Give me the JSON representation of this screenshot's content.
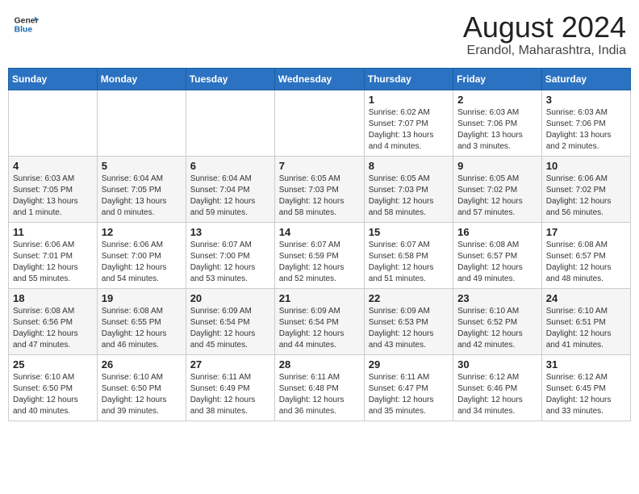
{
  "header": {
    "logo_line1": "General",
    "logo_line2": "Blue",
    "month": "August 2024",
    "location": "Erandol, Maharashtra, India"
  },
  "weekdays": [
    "Sunday",
    "Monday",
    "Tuesday",
    "Wednesday",
    "Thursday",
    "Friday",
    "Saturday"
  ],
  "weeks": [
    [
      {
        "day": "",
        "info": ""
      },
      {
        "day": "",
        "info": ""
      },
      {
        "day": "",
        "info": ""
      },
      {
        "day": "",
        "info": ""
      },
      {
        "day": "1",
        "info": "Sunrise: 6:02 AM\nSunset: 7:07 PM\nDaylight: 13 hours\nand 4 minutes."
      },
      {
        "day": "2",
        "info": "Sunrise: 6:03 AM\nSunset: 7:06 PM\nDaylight: 13 hours\nand 3 minutes."
      },
      {
        "day": "3",
        "info": "Sunrise: 6:03 AM\nSunset: 7:06 PM\nDaylight: 13 hours\nand 2 minutes."
      }
    ],
    [
      {
        "day": "4",
        "info": "Sunrise: 6:03 AM\nSunset: 7:05 PM\nDaylight: 13 hours\nand 1 minute."
      },
      {
        "day": "5",
        "info": "Sunrise: 6:04 AM\nSunset: 7:05 PM\nDaylight: 13 hours\nand 0 minutes."
      },
      {
        "day": "6",
        "info": "Sunrise: 6:04 AM\nSunset: 7:04 PM\nDaylight: 12 hours\nand 59 minutes."
      },
      {
        "day": "7",
        "info": "Sunrise: 6:05 AM\nSunset: 7:03 PM\nDaylight: 12 hours\nand 58 minutes."
      },
      {
        "day": "8",
        "info": "Sunrise: 6:05 AM\nSunset: 7:03 PM\nDaylight: 12 hours\nand 58 minutes."
      },
      {
        "day": "9",
        "info": "Sunrise: 6:05 AM\nSunset: 7:02 PM\nDaylight: 12 hours\nand 57 minutes."
      },
      {
        "day": "10",
        "info": "Sunrise: 6:06 AM\nSunset: 7:02 PM\nDaylight: 12 hours\nand 56 minutes."
      }
    ],
    [
      {
        "day": "11",
        "info": "Sunrise: 6:06 AM\nSunset: 7:01 PM\nDaylight: 12 hours\nand 55 minutes."
      },
      {
        "day": "12",
        "info": "Sunrise: 6:06 AM\nSunset: 7:00 PM\nDaylight: 12 hours\nand 54 minutes."
      },
      {
        "day": "13",
        "info": "Sunrise: 6:07 AM\nSunset: 7:00 PM\nDaylight: 12 hours\nand 53 minutes."
      },
      {
        "day": "14",
        "info": "Sunrise: 6:07 AM\nSunset: 6:59 PM\nDaylight: 12 hours\nand 52 minutes."
      },
      {
        "day": "15",
        "info": "Sunrise: 6:07 AM\nSunset: 6:58 PM\nDaylight: 12 hours\nand 51 minutes."
      },
      {
        "day": "16",
        "info": "Sunrise: 6:08 AM\nSunset: 6:57 PM\nDaylight: 12 hours\nand 49 minutes."
      },
      {
        "day": "17",
        "info": "Sunrise: 6:08 AM\nSunset: 6:57 PM\nDaylight: 12 hours\nand 48 minutes."
      }
    ],
    [
      {
        "day": "18",
        "info": "Sunrise: 6:08 AM\nSunset: 6:56 PM\nDaylight: 12 hours\nand 47 minutes."
      },
      {
        "day": "19",
        "info": "Sunrise: 6:08 AM\nSunset: 6:55 PM\nDaylight: 12 hours\nand 46 minutes."
      },
      {
        "day": "20",
        "info": "Sunrise: 6:09 AM\nSunset: 6:54 PM\nDaylight: 12 hours\nand 45 minutes."
      },
      {
        "day": "21",
        "info": "Sunrise: 6:09 AM\nSunset: 6:54 PM\nDaylight: 12 hours\nand 44 minutes."
      },
      {
        "day": "22",
        "info": "Sunrise: 6:09 AM\nSunset: 6:53 PM\nDaylight: 12 hours\nand 43 minutes."
      },
      {
        "day": "23",
        "info": "Sunrise: 6:10 AM\nSunset: 6:52 PM\nDaylight: 12 hours\nand 42 minutes."
      },
      {
        "day": "24",
        "info": "Sunrise: 6:10 AM\nSunset: 6:51 PM\nDaylight: 12 hours\nand 41 minutes."
      }
    ],
    [
      {
        "day": "25",
        "info": "Sunrise: 6:10 AM\nSunset: 6:50 PM\nDaylight: 12 hours\nand 40 minutes."
      },
      {
        "day": "26",
        "info": "Sunrise: 6:10 AM\nSunset: 6:50 PM\nDaylight: 12 hours\nand 39 minutes."
      },
      {
        "day": "27",
        "info": "Sunrise: 6:11 AM\nSunset: 6:49 PM\nDaylight: 12 hours\nand 38 minutes."
      },
      {
        "day": "28",
        "info": "Sunrise: 6:11 AM\nSunset: 6:48 PM\nDaylight: 12 hours\nand 36 minutes."
      },
      {
        "day": "29",
        "info": "Sunrise: 6:11 AM\nSunset: 6:47 PM\nDaylight: 12 hours\nand 35 minutes."
      },
      {
        "day": "30",
        "info": "Sunrise: 6:12 AM\nSunset: 6:46 PM\nDaylight: 12 hours\nand 34 minutes."
      },
      {
        "day": "31",
        "info": "Sunrise: 6:12 AM\nSunset: 6:45 PM\nDaylight: 12 hours\nand 33 minutes."
      }
    ]
  ]
}
